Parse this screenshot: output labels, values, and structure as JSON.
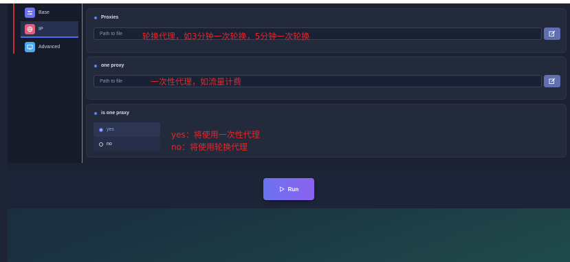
{
  "sidebar": {
    "items": [
      {
        "label": "Base",
        "icon": "sliders-icon",
        "color": "#6b72f0"
      },
      {
        "label": "IP",
        "icon": "globe-icon",
        "color": "#ea5a7a",
        "active": true
      },
      {
        "label": "Advanced",
        "icon": "monitor-icon",
        "color": "#4fa8f0"
      }
    ]
  },
  "proxies": {
    "title": "Proxies",
    "placeholder": "Path to file",
    "annotation": "轮换代理，如3分钟一次轮换，5分钟一次轮换"
  },
  "one_proxy": {
    "title": "one proxy",
    "placeholder": "Path to file",
    "annotation": "一次性代理，如流量计费"
  },
  "is_one_proxy": {
    "title": "is one praxy",
    "options": [
      "yes",
      "no"
    ],
    "selected": "yes",
    "annotation_yes": "yes：将使用一次性代理",
    "annotation_no": "no：将使用轮换代理"
  },
  "run_label": "Run",
  "colors": {
    "accent": "#5d78f0",
    "annotation": "#e2282b"
  }
}
